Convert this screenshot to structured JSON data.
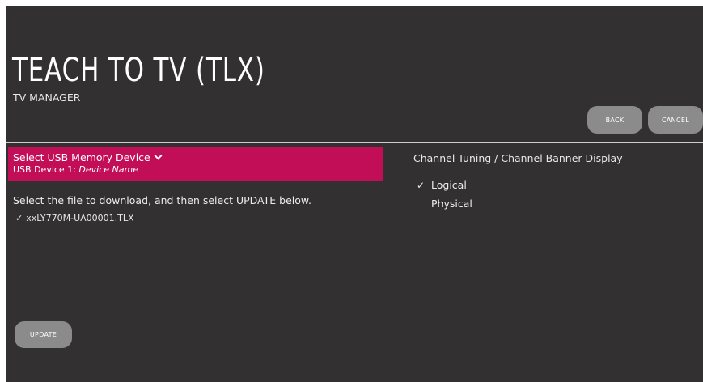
{
  "header": {
    "title": "TEACH TO TV (TLX)",
    "subtitle": "TV MANAGER",
    "back_label": "BACK",
    "cancel_label": "CANCEL"
  },
  "usb": {
    "select_label": "Select USB Memory Device",
    "device_prefix": "USB Device 1:",
    "device_name": "Device Name"
  },
  "files": {
    "instruction": "Select the file to download, and then select UPDATE below.",
    "items": [
      {
        "name": "xxLY770M-UA00001.TLX",
        "selected": true
      }
    ]
  },
  "tuning": {
    "heading": "Channel Tuning / Channel Banner Display",
    "options": [
      {
        "label": "Logical",
        "selected": true
      },
      {
        "label": "Physical",
        "selected": false
      }
    ]
  },
  "update_label": "UPDATE",
  "colors": {
    "background": "#323031",
    "accent": "#c20e56",
    "button": "#8b8b8c"
  },
  "icons": {
    "dropdown": "chevron-down-icon",
    "selected": "check-icon"
  }
}
